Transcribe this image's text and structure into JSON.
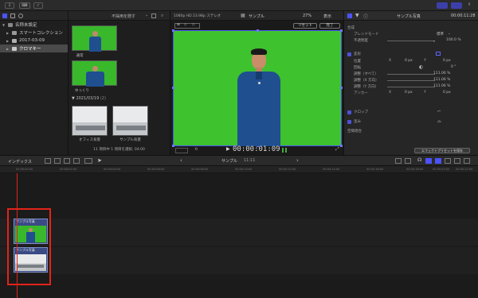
{
  "topbar": {
    "colors": {
      "accent": "#4b53ff"
    }
  },
  "library": {
    "items": [
      {
        "label": "名称未設定"
      },
      {
        "label": "スマートコレクション"
      },
      {
        "label": "2017-03-09"
      },
      {
        "label": "クロマキー"
      }
    ]
  },
  "browser": {
    "filter_label": "不採用を隠す",
    "clips": [
      {
        "label": "通常"
      },
      {
        "label": "ゆっくり"
      }
    ],
    "date_group": {
      "label": "2021/03/19",
      "count": "(2)"
    },
    "clips2": [
      {
        "label": "オフィス背景"
      },
      {
        "label": "サンプル背景"
      }
    ],
    "status": "11 項目中 1 項目を選択, 04:00"
  },
  "viewer": {
    "format": "1080p HD 23.98p ステレオ",
    "title": "サンプル",
    "zoom": "27%",
    "view_menu": "表示",
    "reset_label": "リセット",
    "done_label": "完了",
    "timecode": "00:00:01:09"
  },
  "inspector": {
    "title": "サンプル写真",
    "time": "00:00:11:28",
    "composite_label": "合成",
    "blend_mode_label": "ブレンドモード",
    "blend_mode_value": "標準",
    "opacity_label": "不透明度",
    "opacity_value": "100.0 %",
    "transform_label": "変形",
    "position_label": "位置",
    "pos_x_label": "X",
    "pos_x_value": "0 px",
    "pos_y_label": "Y",
    "pos_y_value": "0 px",
    "rotation_label": "回転",
    "rotation_value": "0 °",
    "scale_all_label": "調整（すべて）",
    "scale_all_value": "111.06 %",
    "scale_x_label": "調整（X 方向）",
    "scale_x_value": "111.06 %",
    "scale_y_label": "調整（Y 方向）",
    "scale_y_value": "111.06 %",
    "anchor_label": "アンカー",
    "anchor_x_label": "X",
    "anchor_x_value": "0 px",
    "anchor_y_label": "Y",
    "anchor_y_value": "0 px",
    "crop_label": "クロップ",
    "distort_label": "歪み",
    "spatial_label": "空間適合",
    "save_preset_label": "エフェクトプリセットを保存"
  },
  "timeline": {
    "index_label": "インデックス",
    "title": "サンプル",
    "duration": "11:11",
    "ruler": [
      "00:00:00:00",
      "00:00:02:00",
      "00:00:04:00",
      "00:00:06:00",
      "00:00:08:00",
      "00:00:10:00",
      "00:00:12:00",
      "00:00:14:00",
      "00:00:16:00",
      "00:00:18:00",
      "00:00:20:00",
      "00:00:22:00"
    ],
    "clips": [
      {
        "label": "サンプル写真"
      },
      {
        "label": "サンプル写真"
      }
    ],
    "highlight_color": "#e2231a"
  }
}
